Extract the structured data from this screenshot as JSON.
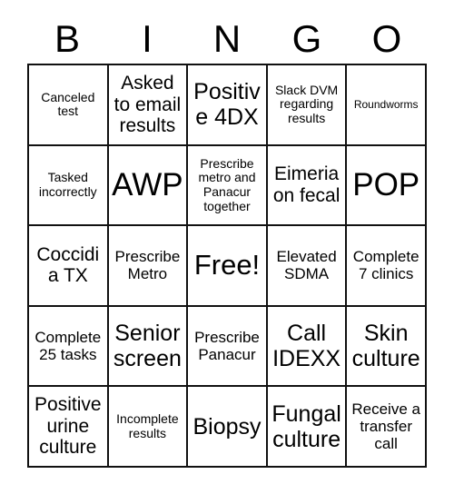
{
  "card": {
    "title": "BINGO",
    "header_letters": [
      "B",
      "I",
      "N",
      "G",
      "O"
    ],
    "grid_size": "5x5",
    "free_space_label": "Free!",
    "colors": {
      "border": "#111111",
      "text": "#000000",
      "background": "#ffffff"
    },
    "rows": [
      [
        {
          "text": "Canceled test",
          "size": "sm"
        },
        {
          "text": "Asked to email results",
          "size": "lg"
        },
        {
          "text": "Positive 4DX",
          "size": "xl"
        },
        {
          "text": "Slack DVM regarding results",
          "size": "sm"
        },
        {
          "text": "Roundworms",
          "size": "xs"
        }
      ],
      [
        {
          "text": "Tasked incorrectly",
          "size": "sm"
        },
        {
          "text": "AWP",
          "size": "mega"
        },
        {
          "text": "Prescribe metro and Panacur together",
          "size": "sm"
        },
        {
          "text": "Eimeria on fecal",
          "size": "lg"
        },
        {
          "text": "POP",
          "size": "mega"
        }
      ],
      [
        {
          "text": "Coccidia TX",
          "size": "lg"
        },
        {
          "text": "Prescribe Metro",
          "size": "md"
        },
        {
          "text": "Free!",
          "size": "xxl"
        },
        {
          "text": "Elevated SDMA",
          "size": "md"
        },
        {
          "text": "Complete 7 clinics",
          "size": "md"
        }
      ],
      [
        {
          "text": "Complete 25 tasks",
          "size": "md"
        },
        {
          "text": "Senior screen",
          "size": "xl"
        },
        {
          "text": "Prescribe Panacur",
          "size": "md"
        },
        {
          "text": "Call IDEXX",
          "size": "xl"
        },
        {
          "text": "Skin culture",
          "size": "xl"
        }
      ],
      [
        {
          "text": "Positive urine culture",
          "size": "lg"
        },
        {
          "text": "Incomplete results",
          "size": "sm"
        },
        {
          "text": "Biopsy",
          "size": "xl"
        },
        {
          "text": "Fungal culture",
          "size": "xl"
        },
        {
          "text": "Receive a transfer call",
          "size": "md"
        }
      ]
    ]
  }
}
